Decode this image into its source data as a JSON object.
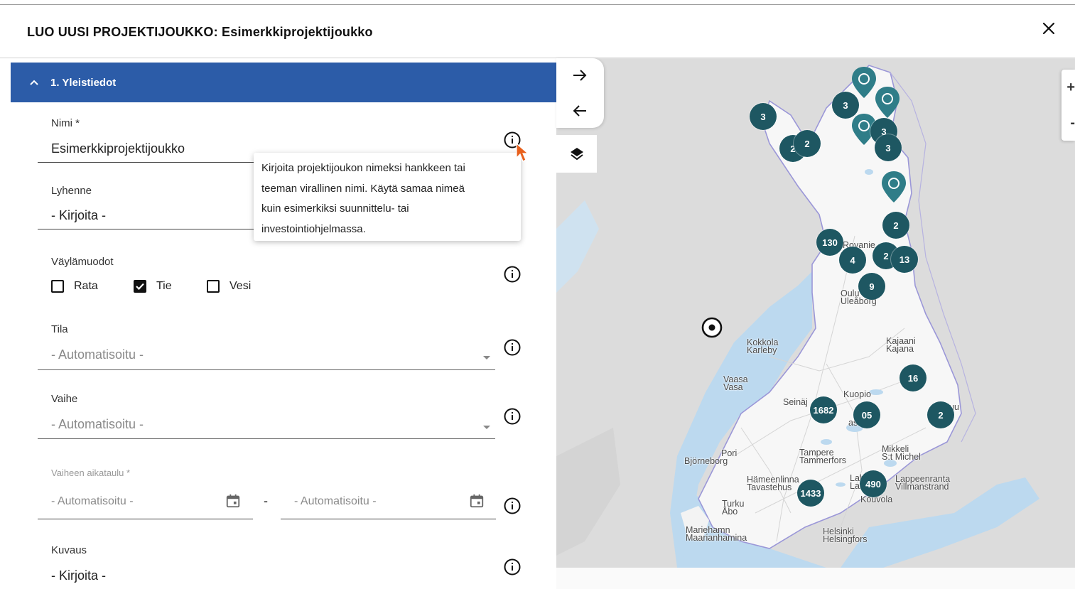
{
  "dialog": {
    "title": "LUO UUSI PROJEKTIJOUKKO: Esimerkkiprojektijoukko",
    "close_icon": "close-icon"
  },
  "section": {
    "label": "1. Yleistiedot",
    "icon": "chevron-up-icon",
    "color": "#2c5ca8"
  },
  "form": {
    "nimi": {
      "label": "Nimi *",
      "value": "Esimerkkiprojektijoukko"
    },
    "lyhenne": {
      "label": "Lyhenne",
      "placeholder": "- Kirjoita -"
    },
    "vaylamuodot": {
      "label": "Väylämuodot",
      "options": [
        {
          "label": "Rata",
          "checked": false
        },
        {
          "label": "Tie",
          "checked": true
        },
        {
          "label": "Vesi",
          "checked": false
        }
      ]
    },
    "tila": {
      "label": "Tila",
      "value": "- Automatisoitu -"
    },
    "vaihe": {
      "label": "Vaihe",
      "value": "- Automatisoitu -"
    },
    "aikataulu": {
      "label": "Vaiheen aikataulu *",
      "start": "- Automatisoitu -",
      "separator": "-",
      "end": "- Automatisoitu -"
    },
    "kuvaus": {
      "label": "Kuvaus",
      "placeholder": "- Kirjoita -"
    }
  },
  "tooltip": {
    "lines": [
      "Kirjoita projektijoukon nimeksi hankkeen tai",
      "teeman virallinen nimi. Käytä samaa nimeä",
      "kuin esimerkiksi suunnittelu- tai",
      "investointiohjelmassa."
    ]
  },
  "map": {
    "controls": {
      "zoom_in": "+",
      "zoom_out": "-"
    },
    "cluster_color": "#1e5762",
    "clusters": [
      "3",
      "3",
      "3",
      "3",
      "2",
      "2",
      "2",
      "130",
      "4",
      "2",
      "13",
      "9",
      "16",
      "1682",
      "05",
      "2",
      "490",
      "1433"
    ],
    "cities": [
      [
        "Rovanie"
      ],
      [
        "Oulu",
        "Uleåborg"
      ],
      [
        "Kokkola",
        "Karleby"
      ],
      [
        "Kajaani",
        "Kajana"
      ],
      [
        "Vaasa",
        "Vasa"
      ],
      [
        "Seinäj"
      ],
      [
        "Kuopio"
      ],
      [
        "askylä"
      ],
      [
        "uu"
      ],
      [
        "Pori",
        "Björneborg"
      ],
      [
        "Tampere",
        "Tammerfors"
      ],
      [
        "Mikkeli",
        "S:t Michel"
      ],
      [
        "Hämeenlinna",
        "Tavastehus"
      ],
      [
        "Lahti",
        "Lahtis"
      ],
      [
        "Lappeenranta",
        "Villmanstrand"
      ],
      [
        "Kouvola"
      ],
      [
        "Turku",
        "Åbo"
      ],
      [
        "Maarianhamina",
        "Mariehamn"
      ],
      [
        "Helsinki",
        "Helsingfors"
      ]
    ]
  }
}
